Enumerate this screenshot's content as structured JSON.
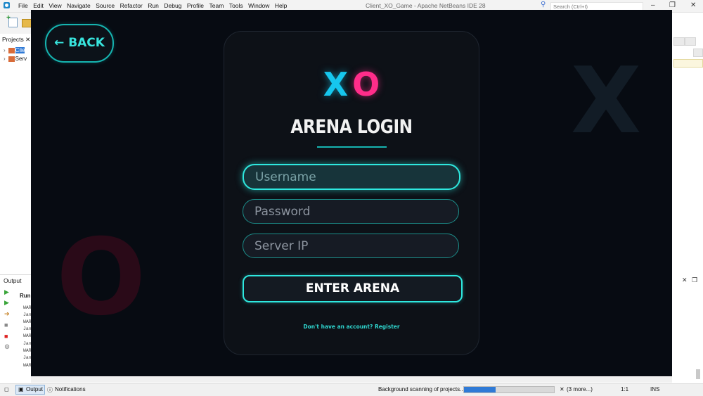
{
  "ide": {
    "window_title": "Client_XO_Game - Apache NetBeans IDE 28",
    "menu": [
      "File",
      "Edit",
      "View",
      "Navigate",
      "Source",
      "Refactor",
      "Run",
      "Debug",
      "Profile",
      "Team",
      "Tools",
      "Window",
      "Help"
    ],
    "search_placeholder": "Search (Ctrl+I)",
    "projects_tab": "Projects",
    "tree": [
      "Clie",
      "Serv"
    ],
    "output_title": "Output",
    "run_label": "Run",
    "log_lines": [
      "WAR",
      "Jan",
      "WAR",
      "Jan",
      "WAR",
      "Jan",
      "WAR",
      "Jan",
      "WAR"
    ],
    "status": {
      "output_tab": "Output",
      "notifications_tab": "Notifications",
      "background_task": "Background scanning of projects...",
      "more": "(3 more...)",
      "position": "1:1",
      "mode": "INS",
      "progress": 0.35
    },
    "icons": {
      "win_min": "–",
      "win_restore": "❐",
      "win_close": "✕",
      "search": "⚲",
      "tree_caret": "›",
      "tab_close": "✕",
      "notif_close": "✕",
      "right_panel_close": "✕",
      "right_panel_restore": "❐"
    }
  },
  "game": {
    "back_label": "← BACK",
    "logo_x": "X",
    "logo_o": "O",
    "title": "ARENA LOGIN",
    "username_placeholder": "Username",
    "password_placeholder": "Password",
    "server_ip_placeholder": "Server IP",
    "enter_label": "ENTER ARENA",
    "register_text": "Don't have an account? Register",
    "bg_x": "X",
    "bg_o": "O",
    "colors": {
      "accent": "#2ee8df",
      "x": "#16c7ee",
      "o": "#ff2d8a",
      "bg": "#070b12"
    }
  }
}
